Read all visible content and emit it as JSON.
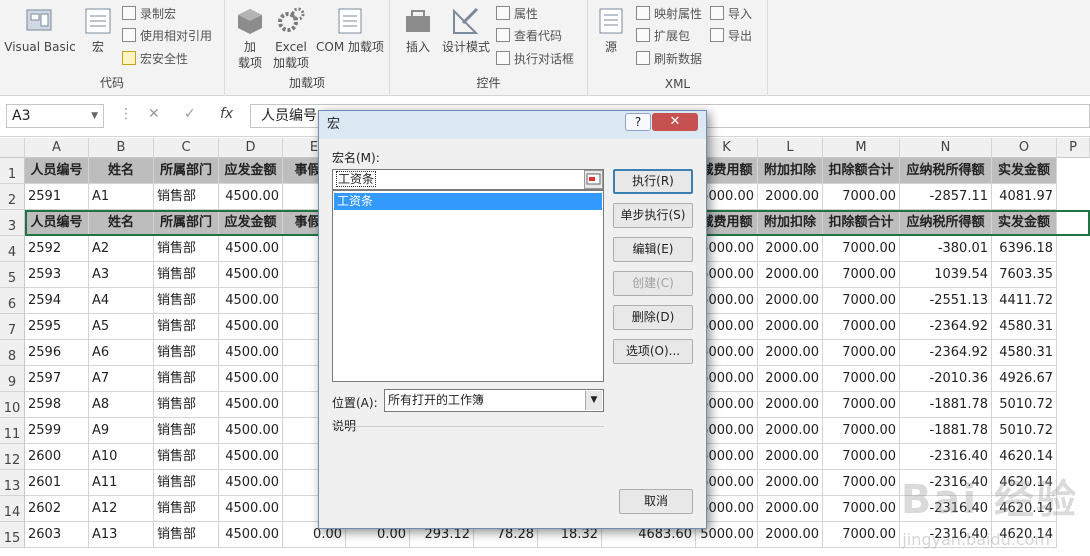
{
  "ribbon": {
    "groups": [
      {
        "label": "代码"
      },
      {
        "label": "加载项"
      },
      {
        "label": "控件"
      },
      {
        "label": "XML"
      }
    ],
    "vb_label": "Visual Basic",
    "macro_label": "宏",
    "record_macro": "录制宏",
    "relative_ref": "使用相对引用",
    "macro_security": "宏安全性",
    "addins_label1": "加",
    "addins_label2": "载项",
    "excel_addins1": "Excel",
    "excel_addins2": "加载项",
    "com_addins": "COM 加载项",
    "insert_label": "插入",
    "design_mode": "设计模式",
    "properties": "属性",
    "view_code": "查看代码",
    "run_dialog": "执行对话框",
    "source_label": "源",
    "map_props": "映射属性",
    "expansion_pack": "扩展包",
    "refresh_data": "刷新数据",
    "import_label": "导入",
    "export_label": "导出"
  },
  "formula_bar": {
    "name_box": "A3",
    "cancel": "✕",
    "enter": "✓",
    "fx": "fx",
    "formula": "人员编号"
  },
  "columns": [
    "A",
    "B",
    "C",
    "D",
    "E",
    "F",
    "G",
    "H",
    "I",
    "J",
    "K",
    "L",
    "M",
    "N",
    "O",
    "P"
  ],
  "headers": [
    "人员编号",
    "姓名",
    "所属部门",
    "应发金额",
    "事假",
    "",
    "",
    "",
    "",
    "",
    "减费用额",
    "附加扣除",
    "扣除额合计",
    "应纳税所得额",
    "实发金额"
  ],
  "rows": [
    {
      "num": "1",
      "cells": [
        "人员编号",
        "姓名",
        "所属部门",
        "应发金额",
        "事假扣",
        "",
        "",
        "",
        "",
        "",
        "减费用额",
        "附加扣除",
        "扣除额合计",
        "应纳税所得额",
        "实发金额"
      ],
      "header": true
    },
    {
      "num": "2",
      "cells": [
        "2591",
        "A1",
        "销售部",
        "4500.00",
        "",
        "",
        "",
        "",
        "",
        "",
        "5000.00",
        "2000.00",
        "7000.00",
        "-2857.11",
        "4081.97"
      ]
    },
    {
      "num": "3",
      "cells": [
        "人员编号",
        "姓名",
        "所属部门",
        "应发金额",
        "事假扣",
        "",
        "",
        "",
        "",
        "",
        "减费用额",
        "附加扣除",
        "扣除额合计",
        "应纳税所得额",
        "实发金额"
      ],
      "header": true
    },
    {
      "num": "4",
      "cells": [
        "2592",
        "A2",
        "销售部",
        "4500.00",
        "",
        "",
        "",
        "",
        "",
        "",
        "5000.00",
        "2000.00",
        "7000.00",
        "-380.01",
        "6396.18"
      ]
    },
    {
      "num": "5",
      "cells": [
        "2593",
        "A3",
        "销售部",
        "4500.00",
        "",
        "",
        "",
        "",
        "",
        "",
        "5000.00",
        "2000.00",
        "7000.00",
        "1039.54",
        "7603.35"
      ]
    },
    {
      "num": "6",
      "cells": [
        "2594",
        "A4",
        "销售部",
        "4500.00",
        "",
        "",
        "",
        "",
        "",
        "",
        "5000.00",
        "2000.00",
        "7000.00",
        "-2551.13",
        "4411.72"
      ]
    },
    {
      "num": "7",
      "cells": [
        "2595",
        "A5",
        "销售部",
        "4500.00",
        "",
        "",
        "",
        "",
        "",
        "",
        "5000.00",
        "2000.00",
        "7000.00",
        "-2364.92",
        "4580.31"
      ]
    },
    {
      "num": "8",
      "cells": [
        "2596",
        "A6",
        "销售部",
        "4500.00",
        "",
        "",
        "",
        "",
        "",
        "",
        "5000.00",
        "2000.00",
        "7000.00",
        "-2364.92",
        "4580.31"
      ]
    },
    {
      "num": "9",
      "cells": [
        "2597",
        "A7",
        "销售部",
        "4500.00",
        "",
        "",
        "",
        "",
        "",
        "",
        "5000.00",
        "2000.00",
        "7000.00",
        "-2010.36",
        "4926.67"
      ]
    },
    {
      "num": "10",
      "cells": [
        "2598",
        "A8",
        "销售部",
        "4500.00",
        "",
        "",
        "",
        "",
        "",
        "",
        "5000.00",
        "2000.00",
        "7000.00",
        "-1881.78",
        "5010.72"
      ]
    },
    {
      "num": "11",
      "cells": [
        "2599",
        "A9",
        "销售部",
        "4500.00",
        "",
        "",
        "",
        "",
        "",
        "",
        "5000.00",
        "2000.00",
        "7000.00",
        "-1881.78",
        "5010.72"
      ]
    },
    {
      "num": "12",
      "cells": [
        "2600",
        "A10",
        "销售部",
        "4500.00",
        "",
        "",
        "",
        "",
        "",
        "",
        "5000.00",
        "2000.00",
        "7000.00",
        "-2316.40",
        "4620.14"
      ]
    },
    {
      "num": "13",
      "cells": [
        "2601",
        "A11",
        "销售部",
        "4500.00",
        "",
        "",
        "",
        "",
        "",
        "",
        "5000.00",
        "2000.00",
        "7000.00",
        "-2316.40",
        "4620.14"
      ]
    },
    {
      "num": "14",
      "cells": [
        "2602",
        "A12",
        "销售部",
        "4500.00",
        "",
        "",
        "",
        "",
        "",
        "",
        "5000.00",
        "2000.00",
        "7000.00",
        "-2316.40",
        "4620.14"
      ]
    },
    {
      "num": "15",
      "cells": [
        "2603",
        "A13",
        "销售部",
        "4500.00",
        "0.00",
        "0.00",
        "293.12",
        "78.28",
        "18.32",
        "4683.60",
        "5000.00",
        "2000.00",
        "7000.00",
        "-2316.40",
        "4620.14"
      ]
    }
  ],
  "dialog": {
    "title": "宏",
    "help": "?",
    "close": "✕",
    "macro_name_label": "宏名(M):",
    "macro_name_value": "工资条",
    "macro_list": [
      "工资条"
    ],
    "buttons": {
      "run": "执行(R)",
      "step": "单步执行(S)",
      "edit": "编辑(E)",
      "create": "创建(C)",
      "delete": "删除(D)",
      "options": "选项(O)...",
      "cancel": "取消"
    },
    "location_label": "位置(A):",
    "location_value": "所有打开的工作簿",
    "description_label": "说明"
  },
  "watermark": "Bai 经验",
  "watermark_url": "jingyan.baidu.com",
  "colors": {
    "accent": "#217346",
    "arrow": "#e0201e",
    "selection": "#3399ff"
  }
}
